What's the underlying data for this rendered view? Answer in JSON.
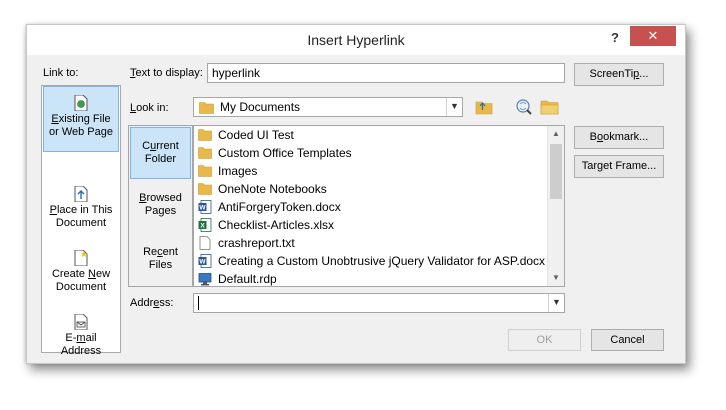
{
  "window": {
    "title": "Insert Hyperlink",
    "help": "?",
    "close": "✕"
  },
  "link_to": {
    "heading": "Link to:",
    "items": [
      {
        "label_ul": "E",
        "label_rest": "xisting File",
        "label_line2": "or Web Page",
        "icon": "web-page-icon",
        "selected": true
      },
      {
        "label_ul": "P",
        "label_rest": "lace in This",
        "label_line2": "Document",
        "icon": "place-in-document-icon",
        "selected": false
      },
      {
        "label_pre": "Create ",
        "label_ul": "N",
        "label_rest": "ew",
        "label_line2": "Document",
        "icon": "new-document-icon",
        "selected": false
      },
      {
        "label_pre": "E-",
        "label_ul": "m",
        "label_rest": "ail",
        "label_line2": "Address",
        "icon": "email-icon",
        "selected": false
      }
    ]
  },
  "text_to_display": {
    "label_ul": "T",
    "label_rest": "ext to display:",
    "value": "hyperlink"
  },
  "screentip": {
    "label_pre": "ScreenTi",
    "label_ul": "p",
    "label_rest": "..."
  },
  "look_in": {
    "label_ul": "L",
    "label_rest": "ook in:",
    "value": "My Documents"
  },
  "nav": [
    {
      "label_pre": "C",
      "label_ul": "u",
      "label_rest": "rrent",
      "label_line2": "Folder",
      "selected": true
    },
    {
      "label_ul": "B",
      "label_rest": "rowsed",
      "label_line2": "Pages",
      "selected": false
    },
    {
      "label_pre": "Re",
      "label_ul": "c",
      "label_rest": "ent",
      "label_line2": "Files",
      "selected": false
    }
  ],
  "files": [
    {
      "name": "Coded UI Test",
      "type": "folder"
    },
    {
      "name": "Custom Office Templates",
      "type": "folder"
    },
    {
      "name": "Images",
      "type": "folder"
    },
    {
      "name": "OneNote Notebooks",
      "type": "folder"
    },
    {
      "name": "AntiForgeryToken.docx",
      "type": "word"
    },
    {
      "name": "Checklist-Articles.xlsx",
      "type": "excel"
    },
    {
      "name": "crashreport.txt",
      "type": "text"
    },
    {
      "name": "Creating a Custom Unobtrusive jQuery Validator for ASP.docx",
      "type": "word"
    },
    {
      "name": "Default.rdp",
      "type": "rdp"
    }
  ],
  "bookmark": {
    "label_pre": "B",
    "label_ul": "o",
    "label_rest": "okmark..."
  },
  "target_frame": {
    "label_pre": "Tar",
    "label_ul": "g",
    "label_rest": "et Frame..."
  },
  "address": {
    "label_pre": "Addr",
    "label_ul": "e",
    "label_rest": "ss:",
    "value": ""
  },
  "ok": "OK",
  "cancel": "Cancel",
  "colors": {
    "close_red": "#c75050",
    "selection_blue": "#cce4f7",
    "folder_yellow": "#e8b94a",
    "word_blue": "#2b5797",
    "excel_green": "#207245"
  }
}
